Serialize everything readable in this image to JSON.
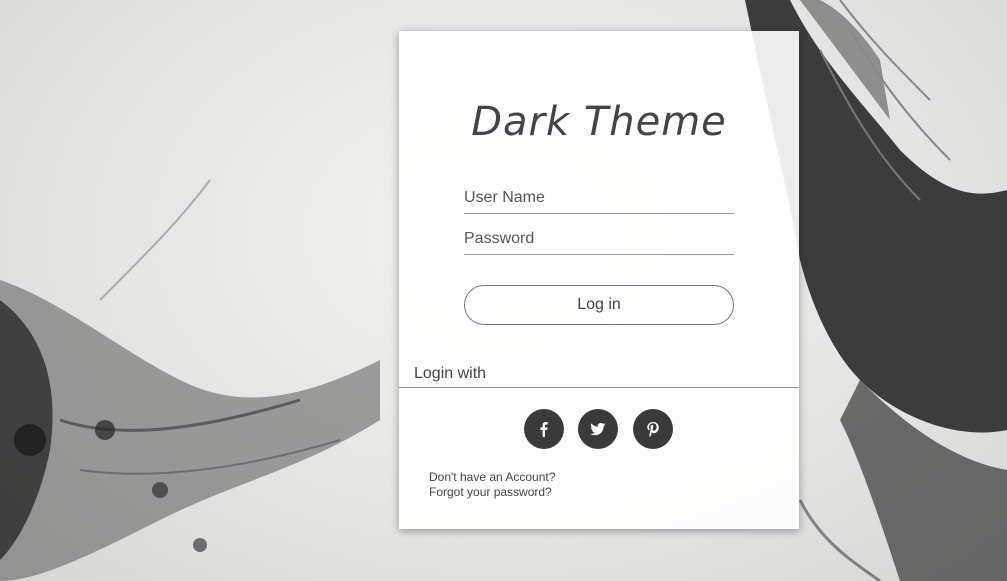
{
  "background": {
    "description_icon": "raven-ink-splash-background"
  },
  "card": {
    "title": "Dark Theme",
    "username": {
      "placeholder": "User Name",
      "value": ""
    },
    "password": {
      "placeholder": "Password",
      "value": ""
    },
    "login_button": "Log in",
    "login_with_label": "Login with",
    "social": [
      {
        "icon": "facebook-icon",
        "glyph": "f"
      },
      {
        "icon": "twitter-icon",
        "glyph": "t"
      },
      {
        "icon": "pinterest-icon",
        "glyph": "p"
      }
    ],
    "links": {
      "no_account": "Don't have an Account?",
      "forgot_password": "Forgot your password?"
    }
  },
  "colors": {
    "text": "#444444",
    "social_bg": "#3a3a3a",
    "card_bg": "#ffffff"
  }
}
